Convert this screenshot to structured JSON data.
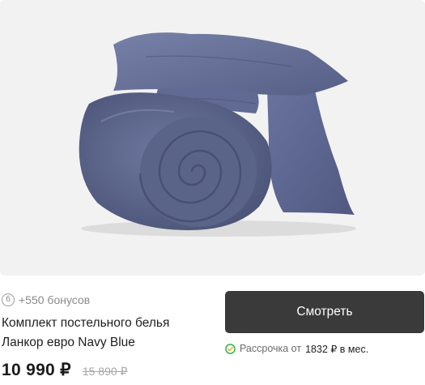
{
  "product": {
    "image_alt": "Комплект постельного белья Ланкор евро Navy Blue",
    "bonus_icon_glyph": "б",
    "bonus_text": "+550 бонусов",
    "title": "Комплект постельного белья Ланкор евро Navy Blue",
    "price": "10 990 ₽",
    "old_price": "15 890 ₽"
  },
  "actions": {
    "watch_label": "Смотреть"
  },
  "installment": {
    "prefix": "Рассрочка от",
    "amount": "1832 ₽ в мес."
  },
  "icons": {
    "bonus": "bonus-coin-icon",
    "installment": "installment-check-icon"
  },
  "colors": {
    "button_bg": "#3a3a3a",
    "button_text": "#ffffff",
    "fabric": "#5e6890",
    "image_bg": "#f2f2f2",
    "muted_text": "#8a8a8a",
    "old_price": "#a8a8a8"
  }
}
